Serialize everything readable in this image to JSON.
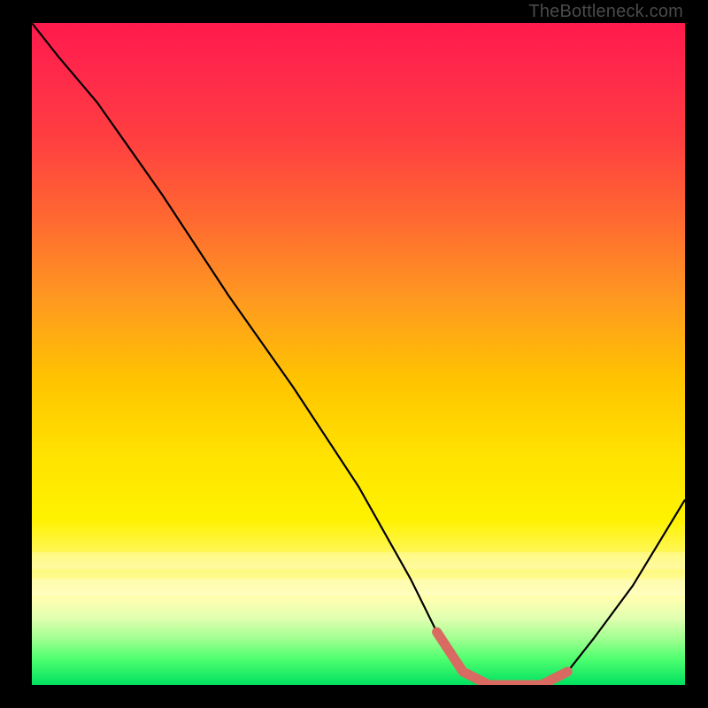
{
  "watermark": "TheBottleneck.com",
  "chart_data": {
    "type": "line",
    "title": "",
    "xlabel": "",
    "ylabel": "",
    "xlim": [
      0,
      100
    ],
    "ylim": [
      0,
      100
    ],
    "series": [
      {
        "name": "bottleneck-curve",
        "x": [
          0,
          4,
          10,
          20,
          30,
          40,
          50,
          58,
          62,
          66,
          70,
          74,
          78,
          82,
          86,
          92,
          100
        ],
        "y": [
          100,
          95,
          88,
          74,
          59,
          45,
          30,
          16,
          8,
          2,
          0,
          0,
          0,
          2,
          7,
          15,
          28
        ]
      },
      {
        "name": "highlight-segment",
        "x": [
          62,
          66,
          70,
          74,
          78,
          82
        ],
        "y": [
          8,
          2,
          0,
          0,
          0,
          2
        ]
      }
    ],
    "colors": {
      "curve": "#000000",
      "highlight": "#d86a62",
      "gradient_top": "#ff1a4d",
      "gradient_mid": "#ffe400",
      "gradient_bottom": "#00e060"
    }
  }
}
